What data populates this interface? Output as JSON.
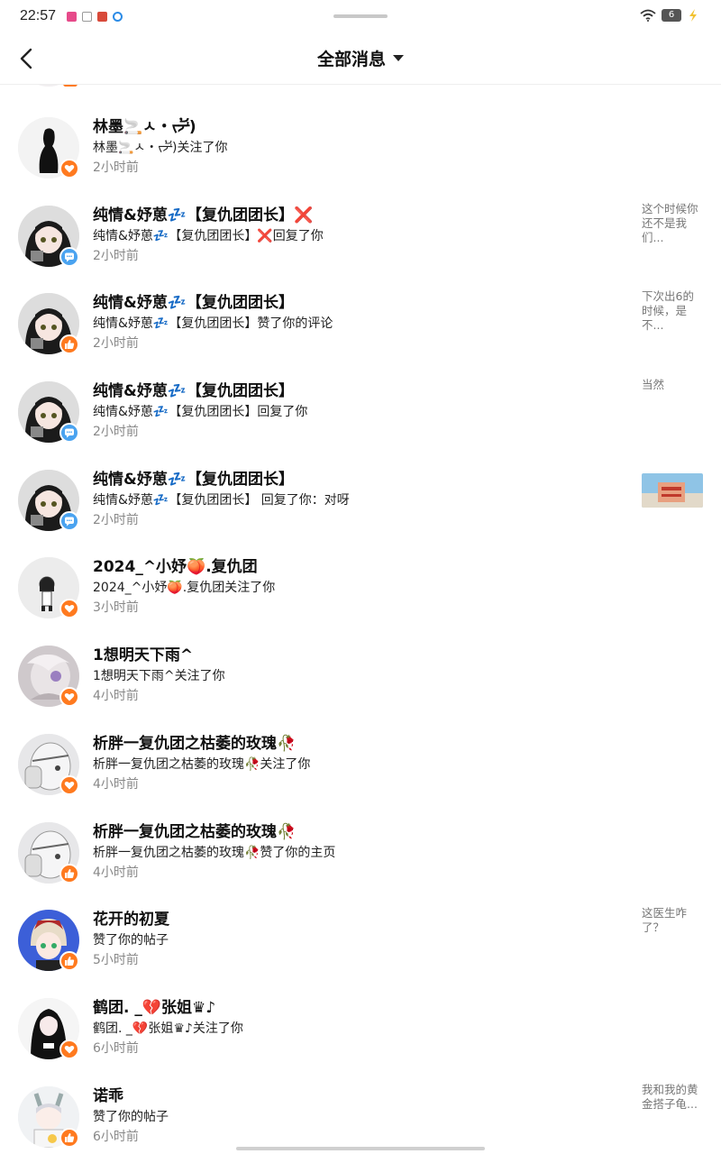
{
  "status_bar": {
    "time": "22:57",
    "battery": "6",
    "icons": [
      "video-app-icon",
      "document-icon",
      "app-icon",
      "browser-icon",
      "wifi-icon",
      "battery-icon",
      "charging-icon"
    ]
  },
  "header": {
    "title": "全部消息",
    "back_icon": "chevron-left-icon",
    "dropdown_icon": "caret-down-icon"
  },
  "colors": {
    "badge_orange": "#ff7a1f",
    "badge_blue": "#4aa3f0",
    "secondary_text": "#888888"
  },
  "messages": [
    {
      "name": "林墨🚬ㅅ・ᡕᠵ᠊ᡃ້)",
      "desc": "林墨🚬ㅅ・ᡕᠵ᠊ᡃ້)关注了你",
      "time": "2小时前",
      "badge": "heart-icon",
      "preview": ""
    },
    {
      "name": "纯情&妤葸💤【复仇团团长】❌",
      "desc": "纯情&妤葸💤【复仇团团长】❌回复了你",
      "time": "2小时前",
      "badge": "chat-bubble-icon",
      "preview": "这个时候你还不是我们..."
    },
    {
      "name": "纯情&妤葸💤【复仇团团长】",
      "desc": "纯情&妤葸💤【复仇团团长】赞了你的评论",
      "time": "2小时前",
      "badge": "thumbs-up-icon",
      "preview": "下次出6的时候，是不..."
    },
    {
      "name": "纯情&妤葸💤【复仇团团长】",
      "desc": "纯情&妤葸💤【复仇团团长】回复了你",
      "time": "2小时前",
      "badge": "chat-bubble-icon",
      "preview": "当然"
    },
    {
      "name": "纯情&妤葸💤【复仇团团长】",
      "desc": "纯情&妤葸💤【复仇团团长】 回复了你：对呀",
      "time": "2小时前",
      "badge": "chat-bubble-icon",
      "preview": ""
    },
    {
      "name": "2024_^小妤🍑.复仇团",
      "desc": "2024_^小妤🍑.复仇团关注了你",
      "time": "3小时前",
      "badge": "heart-icon",
      "preview": ""
    },
    {
      "name": "1想明天下雨^",
      "desc": "1想明天下雨^关注了你",
      "time": "4小时前",
      "badge": "heart-icon",
      "preview": ""
    },
    {
      "name": "析胖一复仇团之枯萎的玫瑰🥀",
      "desc": "析胖一复仇团之枯萎的玫瑰🥀关注了你",
      "time": "4小时前",
      "badge": "heart-icon",
      "preview": ""
    },
    {
      "name": "析胖一复仇团之枯萎的玫瑰🥀",
      "desc": "析胖一复仇团之枯萎的玫瑰🥀赞了你的主页",
      "time": "4小时前",
      "badge": "thumbs-up-icon",
      "preview": ""
    },
    {
      "name": "花开的初夏",
      "desc": "赞了你的帖子",
      "time": "5小时前",
      "badge": "thumbs-up-icon",
      "preview": "这医生咋了？"
    },
    {
      "name": "鹤团. _💔张姐♛♪",
      "desc": "鹤团. _💔张姐♛♪关注了你",
      "time": "6小时前",
      "badge": "heart-icon",
      "preview": ""
    },
    {
      "name": "诺乖",
      "desc": "赞了你的帖子",
      "time": "6小时前",
      "badge": "thumbs-up-icon",
      "preview": "我和我的黄金搭子龟..."
    }
  ]
}
